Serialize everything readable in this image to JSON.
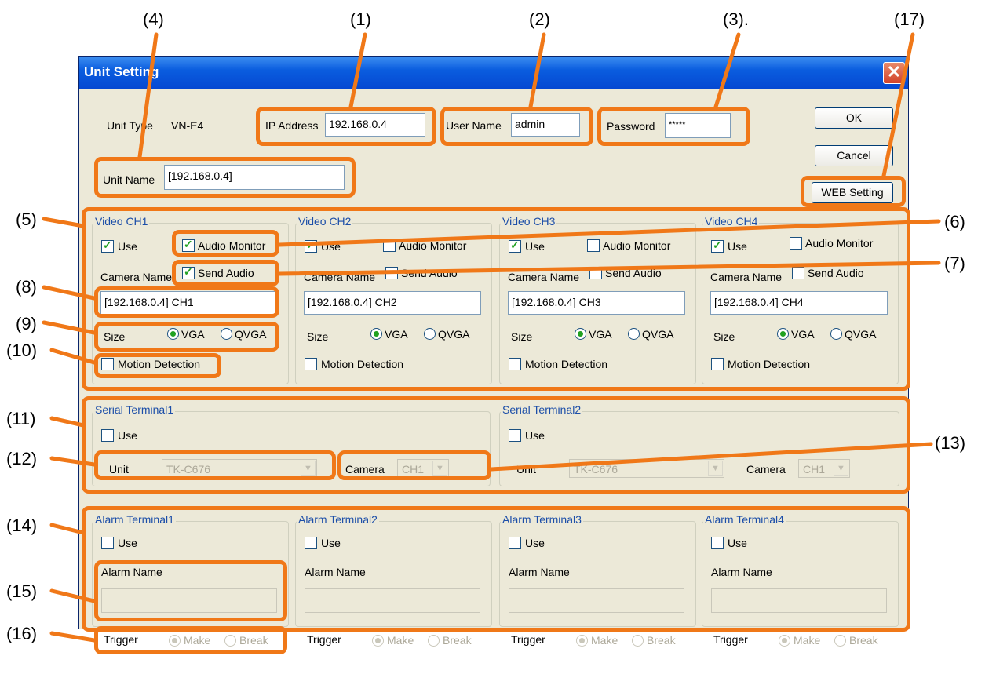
{
  "callouts": [
    "(4)",
    "(1)",
    "(2)",
    "(3).",
    "(17)",
    "(5)",
    "(6)",
    "(7)",
    "(8)",
    "(9)",
    "(10)",
    "(11)",
    "(12)",
    "(13)",
    "(14)",
    "(15)",
    "(16)"
  ],
  "window": {
    "title": "Unit Setting",
    "close_icon": "close-icon"
  },
  "unit": {
    "type_label": "Unit Type",
    "type_value": "VN-E4",
    "ip_label": "IP Address",
    "ip_value": "192.168.0.4",
    "user_label": "User Name",
    "user_value": "admin",
    "password_label": "Password",
    "password_value": "*****",
    "name_label": "Unit Name",
    "name_value": "[192.168.0.4]"
  },
  "buttons": {
    "ok": "OK",
    "cancel": "Cancel",
    "web_setting": "WEB Setting"
  },
  "video_channels": [
    {
      "title": "Video CH1",
      "use": "Use",
      "use_checked": true,
      "audio_monitor": "Audio Monitor",
      "audio_monitor_checked": true,
      "camera_name_label": "Camera Name",
      "send_audio": "Send Audio",
      "send_audio_checked": true,
      "camera_name_value": "[192.168.0.4] CH1",
      "size_label": "Size",
      "vga": "VGA",
      "qvga": "QVGA",
      "size_selected": "VGA",
      "motion_detection": "Motion Detection",
      "motion_checked": false
    },
    {
      "title": "Video CH2",
      "use": "Use",
      "use_checked": true,
      "audio_monitor": "Audio Monitor",
      "audio_monitor_checked": false,
      "camera_name_label": "Camera Name",
      "send_audio": "Send Audio",
      "send_audio_checked": false,
      "camera_name_value": "[192.168.0.4] CH2",
      "size_label": "Size",
      "vga": "VGA",
      "qvga": "QVGA",
      "size_selected": "VGA",
      "motion_detection": "Motion Detection",
      "motion_checked": false
    },
    {
      "title": "Video CH3",
      "use": "Use",
      "use_checked": true,
      "audio_monitor": "Audio Monitor",
      "audio_monitor_checked": false,
      "camera_name_label": "Camera Name",
      "send_audio": "Send Audio",
      "send_audio_checked": false,
      "camera_name_value": "[192.168.0.4] CH3",
      "size_label": "Size",
      "vga": "VGA",
      "qvga": "QVGA",
      "size_selected": "VGA",
      "motion_detection": "Motion Detection",
      "motion_checked": false
    },
    {
      "title": "Video CH4",
      "use": "Use",
      "use_checked": true,
      "audio_monitor": "Audio Monitor",
      "audio_monitor_checked": false,
      "camera_name_label": "Camera Name",
      "send_audio": "Send Audio",
      "send_audio_checked": false,
      "camera_name_value": "[192.168.0.4] CH4",
      "size_label": "Size",
      "vga": "VGA",
      "qvga": "QVGA",
      "size_selected": "VGA",
      "motion_detection": "Motion Detection",
      "motion_checked": false
    }
  ],
  "serial_terminals": [
    {
      "title": "Serial Terminal1",
      "use": "Use",
      "unit_label": "Unit",
      "unit_value": "TK-C676",
      "camera_label": "Camera",
      "camera_value": "CH1"
    },
    {
      "title": "Serial Terminal2",
      "use": "Use",
      "unit_label": "Unit",
      "unit_value": "TK-C676",
      "camera_label": "Camera",
      "camera_value": "CH1"
    }
  ],
  "alarm_terminals": [
    {
      "title": "Alarm Terminal1",
      "use": "Use",
      "alarm_name_label": "Alarm Name",
      "alarm_name_value": "",
      "trigger_label": "Trigger",
      "make": "Make",
      "break": "Break"
    },
    {
      "title": "Alarm Terminal2",
      "use": "Use",
      "alarm_name_label": "Alarm Name",
      "alarm_name_value": "",
      "trigger_label": "Trigger",
      "make": "Make",
      "break": "Break"
    },
    {
      "title": "Alarm Terminal3",
      "use": "Use",
      "alarm_name_label": "Alarm Name",
      "alarm_name_value": "",
      "trigger_label": "Trigger",
      "make": "Make",
      "break": "Break"
    },
    {
      "title": "Alarm Terminal4",
      "use": "Use",
      "alarm_name_label": "Alarm Name",
      "alarm_name_value": "",
      "trigger_label": "Trigger",
      "make": "Make",
      "break": "Break"
    }
  ],
  "colors": {
    "highlight": "#f07818",
    "group_title": "#1c4ea8",
    "dialog_bg": "#ece9d8",
    "titlebar": "#0a5ddf",
    "check": "#21a121"
  }
}
